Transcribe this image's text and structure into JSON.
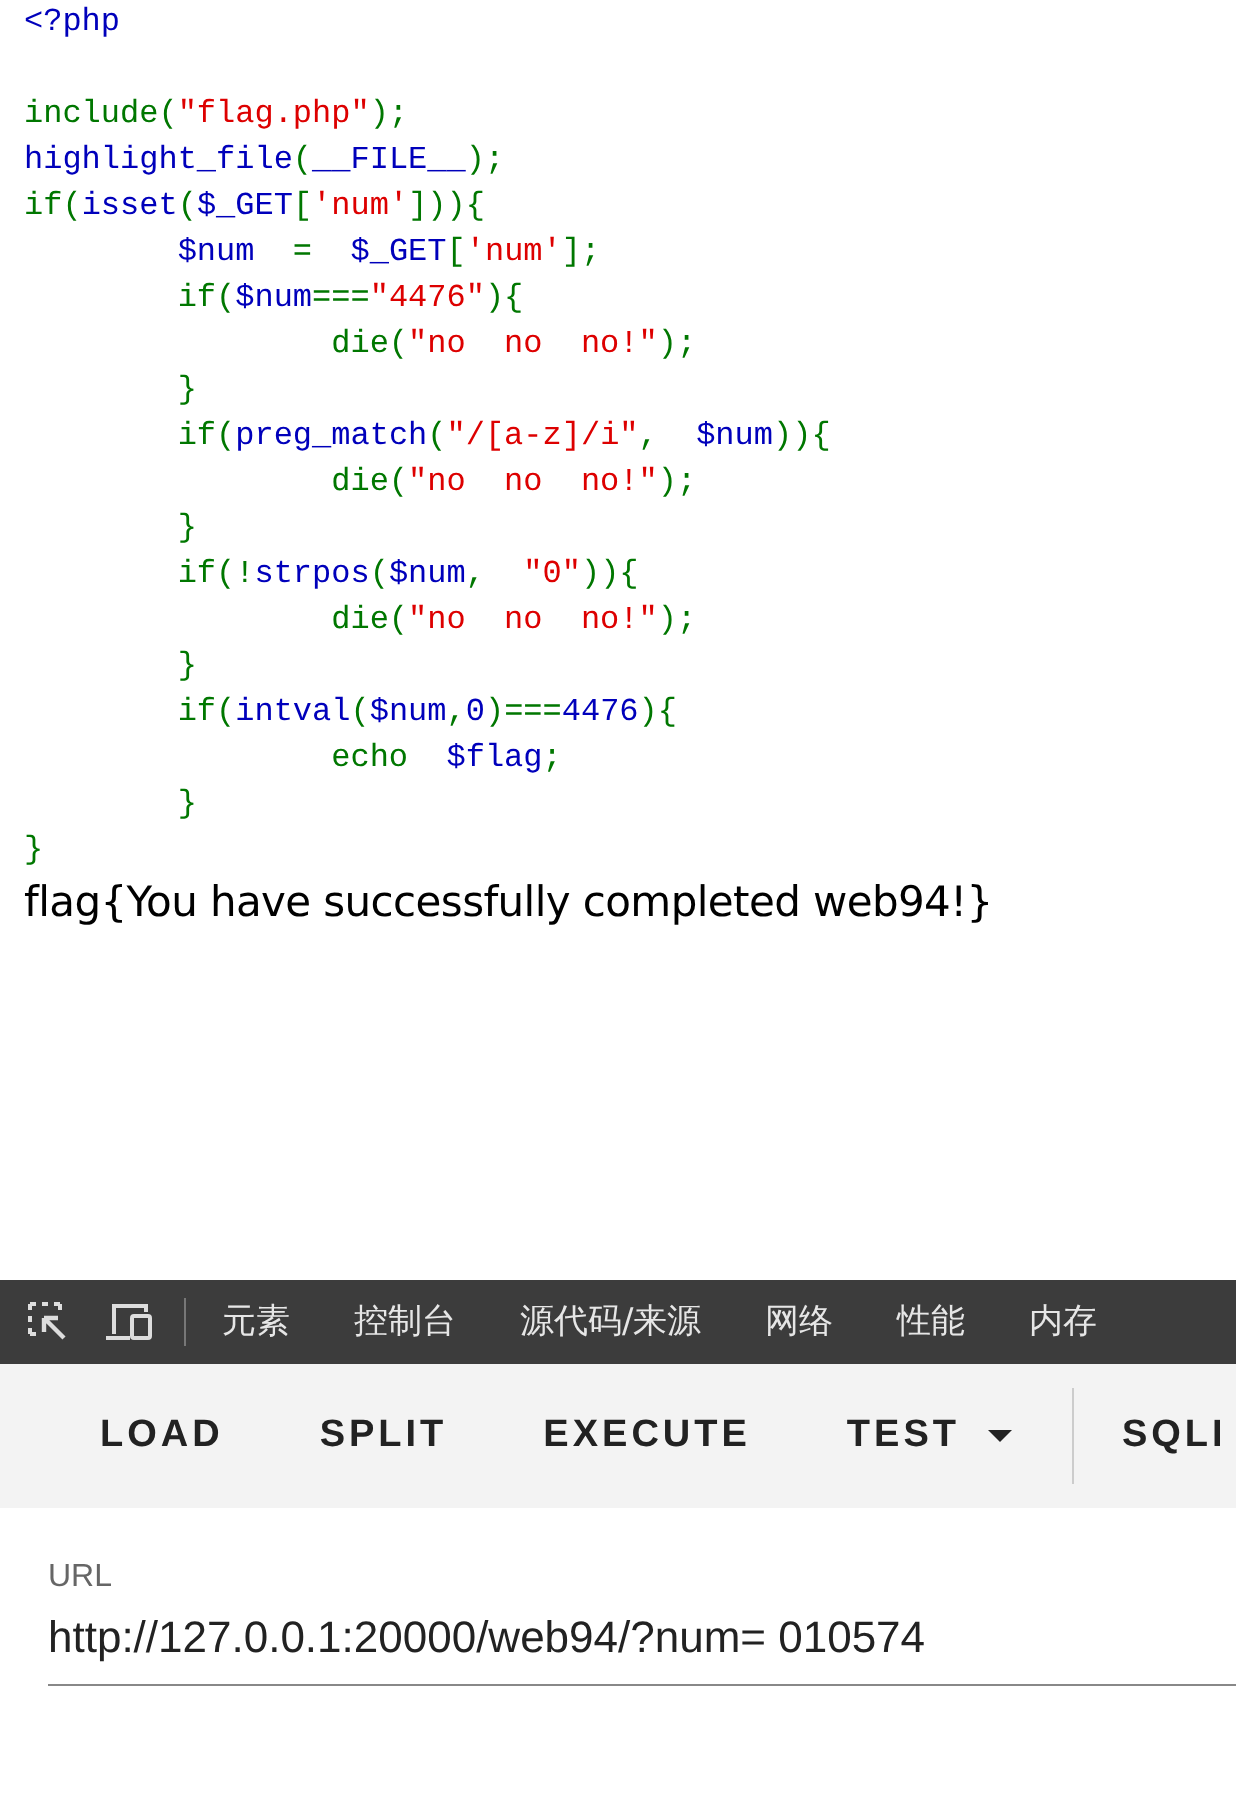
{
  "code": [
    {
      "kind": "code",
      "tokens": [
        {
          "t": "<?php",
          "kind": "default"
        }
      ]
    },
    {
      "kind": "blank"
    },
    {
      "kind": "code",
      "tokens": [
        {
          "t": "include(",
          "kind": "keyword"
        },
        {
          "t": "\"flag.php\"",
          "kind": "string"
        },
        {
          "t": ");",
          "kind": "keyword"
        }
      ]
    },
    {
      "kind": "code",
      "tokens": [
        {
          "t": "highlight_file",
          "kind": "default"
        },
        {
          "t": "(",
          "kind": "keyword"
        },
        {
          "t": "__FILE__",
          "kind": "default"
        },
        {
          "t": ");",
          "kind": "keyword"
        }
      ]
    },
    {
      "kind": "code",
      "tokens": [
        {
          "t": "if(",
          "kind": "keyword"
        },
        {
          "t": "isset",
          "kind": "default"
        },
        {
          "t": "(",
          "kind": "keyword"
        },
        {
          "t": "$_GET",
          "kind": "default"
        },
        {
          "t": "[",
          "kind": "keyword"
        },
        {
          "t": "'num'",
          "kind": "string"
        },
        {
          "t": "])){",
          "kind": "keyword"
        }
      ]
    },
    {
      "kind": "code",
      "tokens": [
        {
          "t": "        $num",
          "kind": "default"
        },
        {
          "t": "  =  ",
          "kind": "keyword"
        },
        {
          "t": "$_GET",
          "kind": "default"
        },
        {
          "t": "[",
          "kind": "keyword"
        },
        {
          "t": "'num'",
          "kind": "string"
        },
        {
          "t": "];",
          "kind": "keyword"
        }
      ]
    },
    {
      "kind": "code",
      "tokens": [
        {
          "t": "        if(",
          "kind": "keyword"
        },
        {
          "t": "$num",
          "kind": "default"
        },
        {
          "t": "===",
          "kind": "keyword"
        },
        {
          "t": "\"4476\"",
          "kind": "string"
        },
        {
          "t": "){",
          "kind": "keyword"
        }
      ]
    },
    {
      "kind": "code",
      "tokens": [
        {
          "t": "                die(",
          "kind": "keyword"
        },
        {
          "t": "\"no  no  no!\"",
          "kind": "string"
        },
        {
          "t": ");",
          "kind": "keyword"
        }
      ]
    },
    {
      "kind": "code",
      "tokens": [
        {
          "t": "        }",
          "kind": "keyword"
        }
      ]
    },
    {
      "kind": "code",
      "tokens": [
        {
          "t": "        if(",
          "kind": "keyword"
        },
        {
          "t": "preg_match",
          "kind": "default"
        },
        {
          "t": "(",
          "kind": "keyword"
        },
        {
          "t": "\"/[a-z]/i\"",
          "kind": "string"
        },
        {
          "t": ",  ",
          "kind": "keyword"
        },
        {
          "t": "$num",
          "kind": "default"
        },
        {
          "t": ")){",
          "kind": "keyword"
        }
      ]
    },
    {
      "kind": "code",
      "tokens": [
        {
          "t": "                die(",
          "kind": "keyword"
        },
        {
          "t": "\"no  no  no!\"",
          "kind": "string"
        },
        {
          "t": ");",
          "kind": "keyword"
        }
      ]
    },
    {
      "kind": "code",
      "tokens": [
        {
          "t": "        }",
          "kind": "keyword"
        }
      ]
    },
    {
      "kind": "code",
      "tokens": [
        {
          "t": "        if(!",
          "kind": "keyword"
        },
        {
          "t": "strpos",
          "kind": "default"
        },
        {
          "t": "(",
          "kind": "keyword"
        },
        {
          "t": "$num",
          "kind": "default"
        },
        {
          "t": ",  ",
          "kind": "keyword"
        },
        {
          "t": "\"0\"",
          "kind": "string"
        },
        {
          "t": ")){",
          "kind": "keyword"
        }
      ]
    },
    {
      "kind": "code",
      "tokens": [
        {
          "t": "                die(",
          "kind": "keyword"
        },
        {
          "t": "\"no  no  no!\"",
          "kind": "string"
        },
        {
          "t": ");",
          "kind": "keyword"
        }
      ]
    },
    {
      "kind": "code",
      "tokens": [
        {
          "t": "        }",
          "kind": "keyword"
        }
      ]
    },
    {
      "kind": "code",
      "tokens": [
        {
          "t": "        if(",
          "kind": "keyword"
        },
        {
          "t": "intval",
          "kind": "default"
        },
        {
          "t": "(",
          "kind": "keyword"
        },
        {
          "t": "$num",
          "kind": "default"
        },
        {
          "t": ",",
          "kind": "keyword"
        },
        {
          "t": "0",
          "kind": "default"
        },
        {
          "t": ")===",
          "kind": "keyword"
        },
        {
          "t": "4476",
          "kind": "default"
        },
        {
          "t": "){",
          "kind": "keyword"
        }
      ]
    },
    {
      "kind": "code",
      "tokens": [
        {
          "t": "                echo  ",
          "kind": "keyword"
        },
        {
          "t": "$flag",
          "kind": "default"
        },
        {
          "t": ";",
          "kind": "keyword"
        }
      ]
    },
    {
      "kind": "code",
      "tokens": [
        {
          "t": "        }",
          "kind": "keyword"
        }
      ]
    },
    {
      "kind": "code",
      "tokens": [
        {
          "t": "}",
          "kind": "keyword"
        }
      ]
    }
  ],
  "output": "flag{You have successfully completed web94!}",
  "devtools": {
    "tabs": [
      {
        "label": "元素",
        "selected": false
      },
      {
        "label": "控制台",
        "selected": false
      },
      {
        "label": "源代码/来源",
        "selected": false
      },
      {
        "label": "网络",
        "selected": false
      },
      {
        "label": "性能",
        "selected": false
      },
      {
        "label": "内存",
        "selected": false
      }
    ]
  },
  "hackbar": {
    "buttons": [
      {
        "label": "LOAD",
        "kind": "plain"
      },
      {
        "label": "SPLIT",
        "kind": "plain"
      },
      {
        "label": "EXECUTE",
        "kind": "plain"
      },
      {
        "label": "TEST",
        "kind": "dropdown"
      },
      {
        "label": "SQLI",
        "kind": "plain"
      }
    ],
    "url": {
      "label": "URL",
      "value": "http://127.0.0.1:20000/web94/?num= 010574"
    }
  }
}
